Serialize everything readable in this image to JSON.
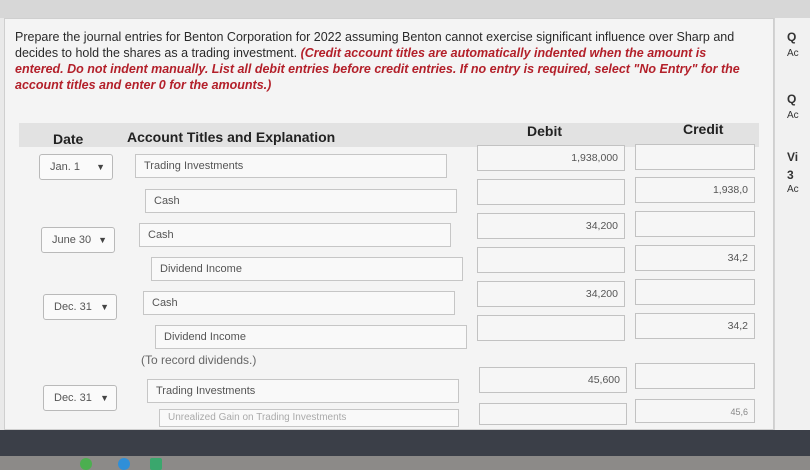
{
  "instructions": {
    "plain": "Prepare the journal entries for Benton Corporation for 2022 assuming Benton cannot exercise significant influence over Sharp and decides to hold the shares as a trading investment.",
    "emphasis": "(Credit account titles are automatically indented when the amount is entered. Do not indent manually. List all debit entries before credit entries. If no entry is required, select \"No Entry\" for the account titles and enter 0 for the amounts.)"
  },
  "table": {
    "headers": {
      "date": "Date",
      "account": "Account Titles and Explanation",
      "debit": "Debit",
      "credit": "Credit"
    },
    "entries": [
      {
        "date": "Jan. 1",
        "lines": [
          {
            "account": "Trading Investments",
            "debit": "1,938,000",
            "credit": ""
          },
          {
            "account": "Cash",
            "debit": "",
            "credit": "1,938,0"
          }
        ]
      },
      {
        "date": "June 30",
        "lines": [
          {
            "account": "Cash",
            "debit": "34,200",
            "credit": ""
          },
          {
            "account": "Dividend Income",
            "debit": "",
            "credit": "34,2"
          }
        ]
      },
      {
        "date": "Dec. 31",
        "lines": [
          {
            "account": "Cash",
            "debit": "34,200",
            "credit": ""
          },
          {
            "account": "Dividend Income",
            "debit": "",
            "credit": "34,2"
          }
        ],
        "note": "(To record dividends.)"
      },
      {
        "date": "Dec. 31",
        "lines": [
          {
            "account": "Trading Investments",
            "debit": "45,600",
            "credit": ""
          },
          {
            "account": "Unrealized Gain on Trading Investments",
            "debit": "",
            "credit": "45,6"
          }
        ]
      }
    ]
  },
  "right_column": {
    "q1": "Q",
    "a1": "Ac",
    "q2": "Q",
    "a2": "Ac",
    "v": "Vi",
    "num": "3",
    "a3": "Ac"
  },
  "chevron_glyph": "⌵",
  "colors": {
    "instruction_emphasis": "#b3202a"
  }
}
